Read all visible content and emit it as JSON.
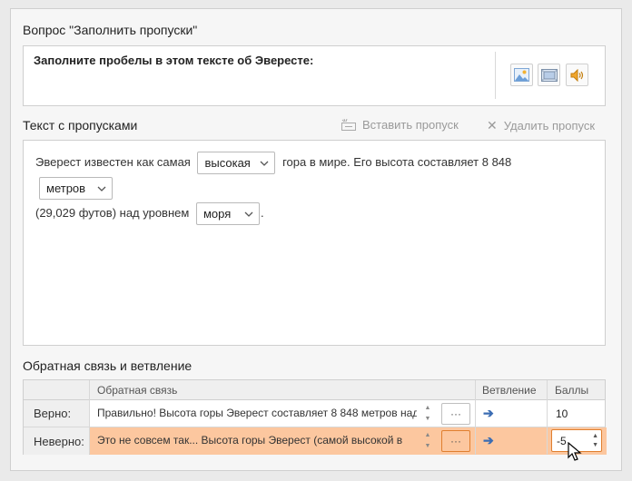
{
  "question": {
    "section_title": "Вопрос \"Заполнить пропуски\"",
    "text": "Заполните пробелы в этом тексте об Эвересте:"
  },
  "gaps": {
    "section_title": "Текст с пропусками",
    "insert_label": "Вставить пропуск",
    "delete_label": "Удалить пропуск",
    "text_1": "Эверест известен как самая",
    "select_1": "высокая",
    "text_2": "гора в мире. Его высота составляет 8 848",
    "select_2": "метров",
    "text_3": "(29,029 футов) над уровнем",
    "select_3": "моря",
    "text_4": "."
  },
  "feedback": {
    "section_title": "Обратная связь и ветвление",
    "col_feedback": "Обратная связь",
    "col_branch": "Ветвление",
    "col_score": "Баллы",
    "rows": [
      {
        "label": "Верно:",
        "text": "Правильно! Высота горы Эверест составляет 8 848 метров над",
        "dots": "···",
        "score": "10"
      },
      {
        "label": "Неверно:",
        "text": "Это не совсем так... Высота горы Эверест (самой высокой в",
        "dots": "···",
        "score": "-5"
      }
    ]
  },
  "icons": [
    "image-icon",
    "video-icon",
    "audio-icon",
    "insert-gap-icon",
    "delete-icon",
    "arrow-right-icon",
    "chevron-down-icon"
  ],
  "colors": {
    "selected_row": "#fcc79f",
    "arrow": "#3b6db3",
    "accent_border": "#e07f2f"
  }
}
